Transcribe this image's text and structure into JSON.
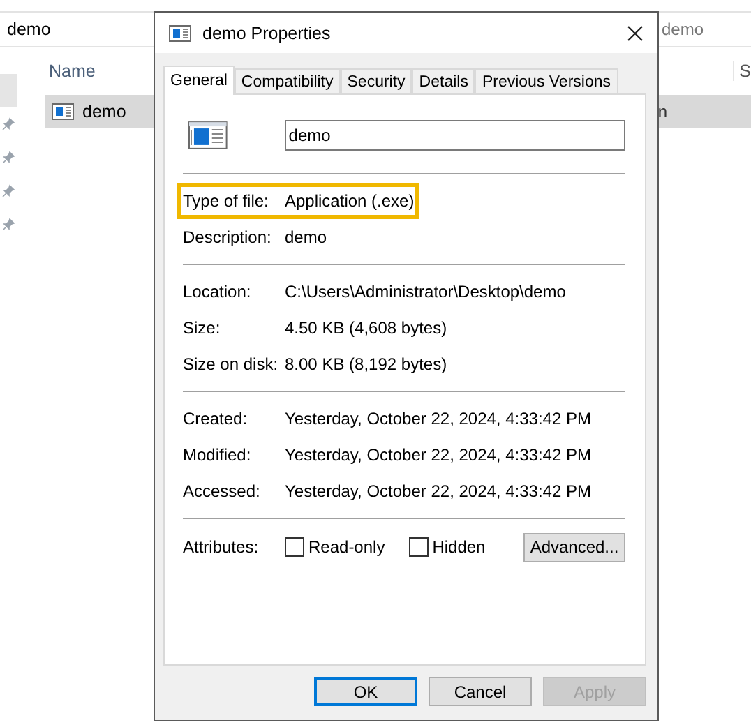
{
  "explorer": {
    "address": "demo",
    "search": "demo",
    "columns": [
      "Name",
      "S"
    ],
    "rows": [
      {
        "name": "demo",
        "column_2": "n",
        "selected": true
      }
    ]
  },
  "dialog": {
    "title": "demo Properties",
    "tabs": [
      {
        "label": "General",
        "selected": true
      },
      {
        "label": "Compatibility",
        "selected": false
      },
      {
        "label": "Security",
        "selected": false
      },
      {
        "label": "Details",
        "selected": false
      },
      {
        "label": "Previous Versions",
        "selected": false
      }
    ],
    "file_name": "demo",
    "sections": [
      [
        {
          "label": "Type of file:",
          "value": "Application (.exe)",
          "highlighted": true
        },
        {
          "label": "Description:",
          "value": "demo",
          "highlighted": false
        }
      ],
      [
        {
          "label": "Location:",
          "value": "C:\\Users\\Administrator\\Desktop\\demo",
          "highlighted": false
        },
        {
          "label": "Size:",
          "value": "4.50 KB (4,608 bytes)",
          "highlighted": false
        },
        {
          "label": "Size on disk:",
          "value": "8.00 KB (8,192 bytes)",
          "highlighted": false
        }
      ],
      [
        {
          "label": "Created:",
          "value": "Yesterday, October 22, 2024, 4:33:42 PM",
          "highlighted": false
        },
        {
          "label": "Modified:",
          "value": "Yesterday, October 22, 2024, 4:33:42 PM",
          "highlighted": false
        },
        {
          "label": "Accessed:",
          "value": "Yesterday, October 22, 2024, 4:33:42 PM",
          "highlighted": false
        }
      ]
    ],
    "attributes": {
      "label": "Attributes:",
      "options": [
        {
          "label": "Read-only",
          "checked": false
        },
        {
          "label": "Hidden",
          "checked": false
        }
      ],
      "advanced": "Advanced..."
    },
    "buttons": [
      {
        "label": "OK",
        "kind": "default"
      },
      {
        "label": "Cancel",
        "kind": "normal"
      },
      {
        "label": "Apply",
        "kind": "disabled"
      }
    ]
  }
}
